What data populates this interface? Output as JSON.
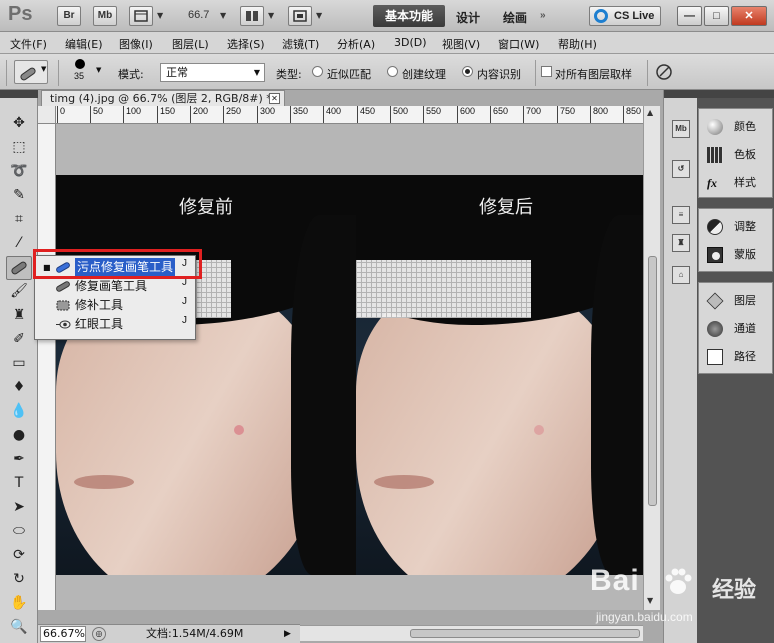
{
  "app": {
    "logo": "Ps",
    "bridge_label": "Br",
    "minibridge_label": "Mb",
    "zoom": "66.7",
    "workspaces": [
      "基本功能",
      "设计",
      "绘画"
    ],
    "more_label": "»",
    "cslive": "CS Live",
    "window_buttons": [
      "—",
      "□",
      "✕"
    ]
  },
  "menu": [
    "文件(F)",
    "编辑(E)",
    "图像(I)",
    "图层(L)",
    "选择(S)",
    "滤镜(T)",
    "分析(A)",
    "3D(D)",
    "视图(V)",
    "窗口(W)",
    "帮助(H)"
  ],
  "options": {
    "brush_size": "35",
    "mode_label": "模式:",
    "mode_value": "正常",
    "type_label": "类型:",
    "types": [
      "近似匹配",
      "创建纹理",
      "内容识别"
    ],
    "type_selected": 2,
    "sample_all_label": "对所有图层取样"
  },
  "document": {
    "tab_title": "timg (4).jpg @ 66.7% (图层 2, RGB/8#) *",
    "ruler_ticks": [
      "0",
      "50",
      "100",
      "150",
      "200",
      "250",
      "300",
      "350",
      "400",
      "450",
      "500",
      "550",
      "600",
      "650",
      "700",
      "750",
      "800",
      "850"
    ],
    "captions": [
      "修复前",
      "修复后"
    ]
  },
  "flyout": {
    "items": [
      {
        "label": "污点修复画笔工具",
        "key": "J",
        "icon": "spot-healing-brush-icon",
        "active": true
      },
      {
        "label": "修复画笔工具",
        "key": "J",
        "icon": "healing-brush-icon",
        "active": false
      },
      {
        "label": "修补工具",
        "key": "J",
        "icon": "patch-icon",
        "active": false
      },
      {
        "label": "红眼工具",
        "key": "J",
        "icon": "red-eye-icon",
        "active": false
      }
    ]
  },
  "panels": {
    "dock_icons": [
      "Mb"
    ],
    "group1": [
      "颜色",
      "色板",
      "样式"
    ],
    "group2": [
      "调整",
      "蒙版"
    ],
    "group3": [
      "图层",
      "通道",
      "路径"
    ]
  },
  "status": {
    "zoom": "66.67%",
    "doc_info": "文档:1.54M/4.69M"
  },
  "watermark": {
    "brand": "Bai",
    "brand2": "经验",
    "url": "jingyan.baidu.com"
  },
  "colors": {
    "highlight": "#e02020",
    "active_workspace": "#444444",
    "selection": "#2a5ec8"
  }
}
